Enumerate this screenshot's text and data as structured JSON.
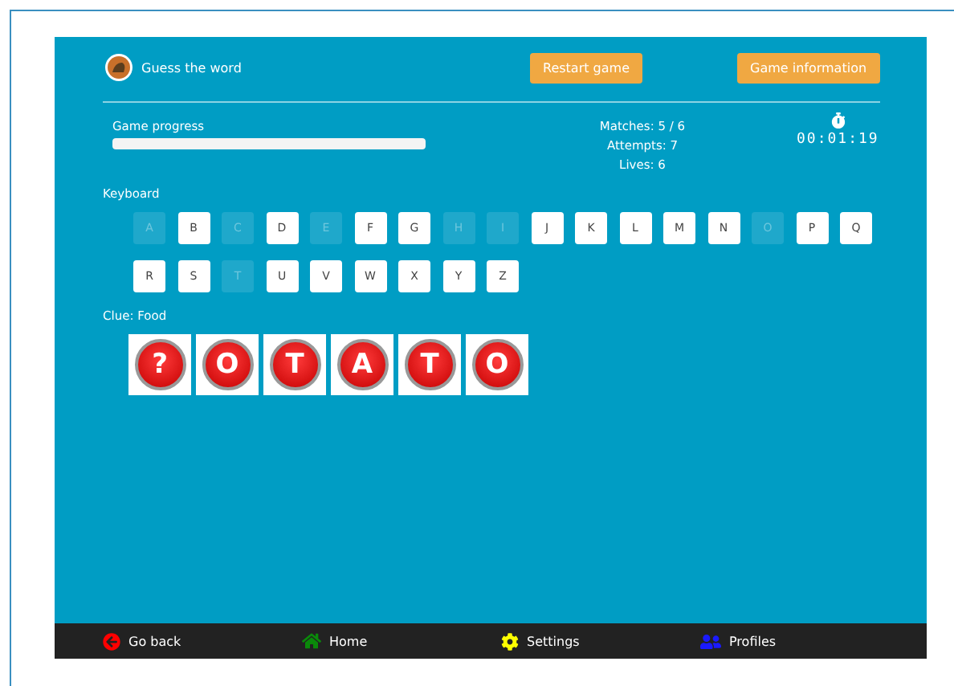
{
  "header": {
    "title": "Guess the word",
    "buttons": [
      "Restart game",
      "Game information"
    ]
  },
  "progress": {
    "label": "Game progress",
    "level": 1
  },
  "stats": [
    "Matches: 5 / 6",
    "Attempts: 7",
    "Lives: 6"
  ],
  "timer": "00:01:19",
  "keyboard": {
    "label": "Keyboard",
    "keys": [
      {
        "letter": "A",
        "disabled": true
      },
      {
        "letter": "B",
        "disabled": false
      },
      {
        "letter": "C",
        "disabled": true
      },
      {
        "letter": "D",
        "disabled": false
      },
      {
        "letter": "E",
        "disabled": true
      },
      {
        "letter": "F",
        "disabled": false
      },
      {
        "letter": "G",
        "disabled": false
      },
      {
        "letter": "H",
        "disabled": true
      },
      {
        "letter": "I",
        "disabled": true
      },
      {
        "letter": "J",
        "disabled": false
      },
      {
        "letter": "K",
        "disabled": false
      },
      {
        "letter": "L",
        "disabled": false
      },
      {
        "letter": "M",
        "disabled": false
      },
      {
        "letter": "N",
        "disabled": false
      },
      {
        "letter": "O",
        "disabled": true
      },
      {
        "letter": "P",
        "disabled": false
      },
      {
        "letter": "Q",
        "disabled": false
      },
      {
        "letter": "R",
        "disabled": false
      },
      {
        "letter": "S",
        "disabled": false
      },
      {
        "letter": "T",
        "disabled": true
      },
      {
        "letter": "U",
        "disabled": false
      },
      {
        "letter": "V",
        "disabled": false
      },
      {
        "letter": "W",
        "disabled": false
      },
      {
        "letter": "X",
        "disabled": false
      },
      {
        "letter": "Y",
        "disabled": false
      },
      {
        "letter": "Z",
        "disabled": false
      }
    ]
  },
  "clue": "Clue: Food",
  "word": [
    "?",
    "O",
    "T",
    "A",
    "T",
    "O"
  ],
  "footer": [
    {
      "label": "Go back",
      "kind": "back"
    },
    {
      "label": "Home",
      "kind": "home"
    },
    {
      "label": "Settings",
      "kind": "settings"
    },
    {
      "label": "Profiles",
      "kind": "profiles"
    }
  ]
}
